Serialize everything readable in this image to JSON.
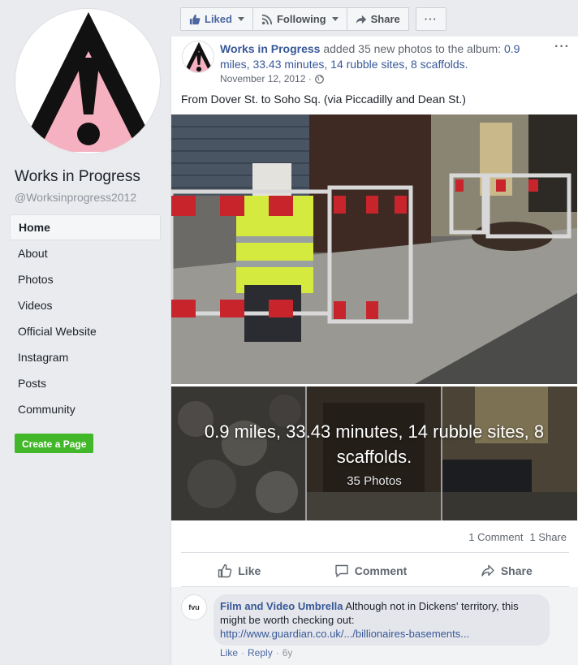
{
  "sidebar": {
    "page_name": "Works in Progress",
    "page_handle": "@Worksinprogress2012",
    "nav": [
      {
        "label": "Home",
        "active": true
      },
      {
        "label": "About"
      },
      {
        "label": "Photos"
      },
      {
        "label": "Videos"
      },
      {
        "label": "Official Website"
      },
      {
        "label": "Instagram"
      },
      {
        "label": "Posts"
      },
      {
        "label": "Community"
      }
    ],
    "create_page_label": "Create a Page"
  },
  "action_bar": {
    "liked_label": "Liked",
    "following_label": "Following",
    "share_label": "Share",
    "more_label": "···"
  },
  "post": {
    "author": "Works in Progress",
    "action_text": " added 35 new photos to the album: ",
    "album_title": "0.9 miles, 33.43 minutes, 14 rubble sites, 8 scaffolds.",
    "date": "November 12, 2012 · ",
    "more_label": "···",
    "text": "From Dover St. to Soho Sq. (via Piccadilly and Dean St.)",
    "album_overlay_title": "0.9 miles, 33.43 minutes, 14 rubble sites, 8 scaffolds.",
    "album_overlay_count": "35 Photos",
    "comments_count": "1 Comment",
    "shares_count": "1 Share",
    "actions": {
      "like": "Like",
      "comment": "Comment",
      "share": "Share"
    }
  },
  "comment": {
    "avatar_text": "fvu",
    "author": "Film and Video Umbrella",
    "text": " Although not in Dickens' territory, this might be worth checking out:",
    "link": "http://www.guardian.co.uk/.../billionaires-basements...",
    "like": "Like",
    "separator": "·",
    "reply": "Reply",
    "age": "6y"
  },
  "colors": {
    "brand_link": "#385898",
    "create_button": "#42b72a",
    "avatar_pink": "#f6b1c0"
  },
  "icons": [
    "warning-sign-icon",
    "thumbs-up-icon",
    "rss-icon",
    "share-arrow-icon",
    "globe-icon",
    "comment-icon"
  ]
}
